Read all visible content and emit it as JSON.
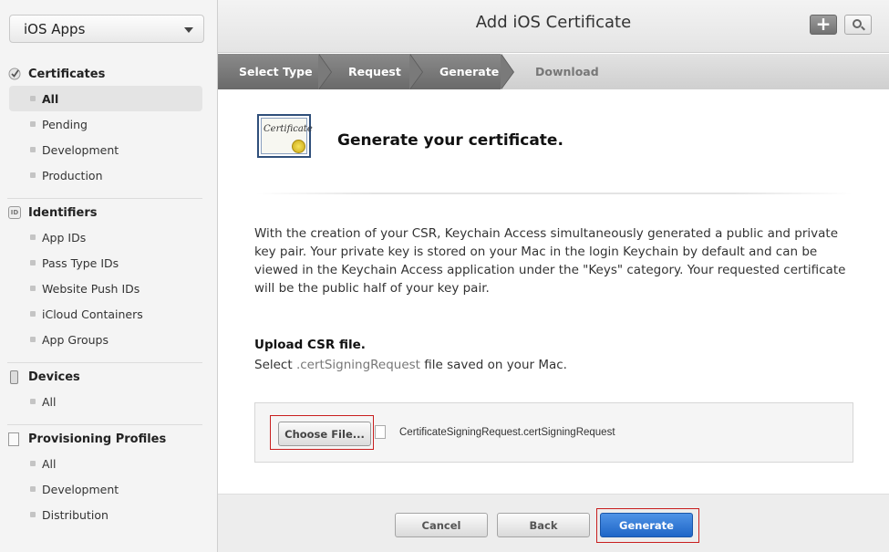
{
  "sidebar": {
    "app_selector": "iOS Apps",
    "sections": {
      "certificates": {
        "title": "Certificates",
        "items": [
          "All",
          "Pending",
          "Development",
          "Production"
        ]
      },
      "identifiers": {
        "title": "Identifiers",
        "icon_text": "ID",
        "items": [
          "App IDs",
          "Pass Type IDs",
          "Website Push IDs",
          "iCloud Containers",
          "App Groups"
        ]
      },
      "devices": {
        "title": "Devices",
        "items": [
          "All"
        ]
      },
      "provisioning": {
        "title": "Provisioning Profiles",
        "items": [
          "All",
          "Development",
          "Distribution"
        ]
      }
    },
    "active_item": "certificates.All"
  },
  "header": {
    "title": "Add iOS Certificate",
    "add_button_icon": "plus-icon",
    "search_button_icon": "search-icon"
  },
  "steps": [
    "Select Type",
    "Request",
    "Generate",
    "Download"
  ],
  "current_step": "Generate",
  "content": {
    "heading": "Generate your certificate.",
    "cert_icon_text": "Certificate",
    "description": "With the creation of your CSR, Keychain Access simultaneously generated a public and private key pair. Your private key is stored on your Mac in the login Keychain by default and can be viewed in the Keychain Access application under the \"Keys\" category. Your requested certificate will be the public half of your key pair.",
    "upload_title": "Upload CSR file.",
    "upload_sub_prefix": "Select ",
    "upload_sub_ext": ".certSigningRequest",
    "upload_sub_suffix": " file saved on your Mac.",
    "choose_file_label": "Choose File...",
    "file_name": "CertificateSigningRequest.certSigningRequest"
  },
  "footer": {
    "cancel": "Cancel",
    "back": "Back",
    "generate": "Generate"
  },
  "colors": {
    "primary_button": "#1f66c7",
    "highlight_box": "#c81e1e",
    "step_done": "#7a7a7a"
  }
}
